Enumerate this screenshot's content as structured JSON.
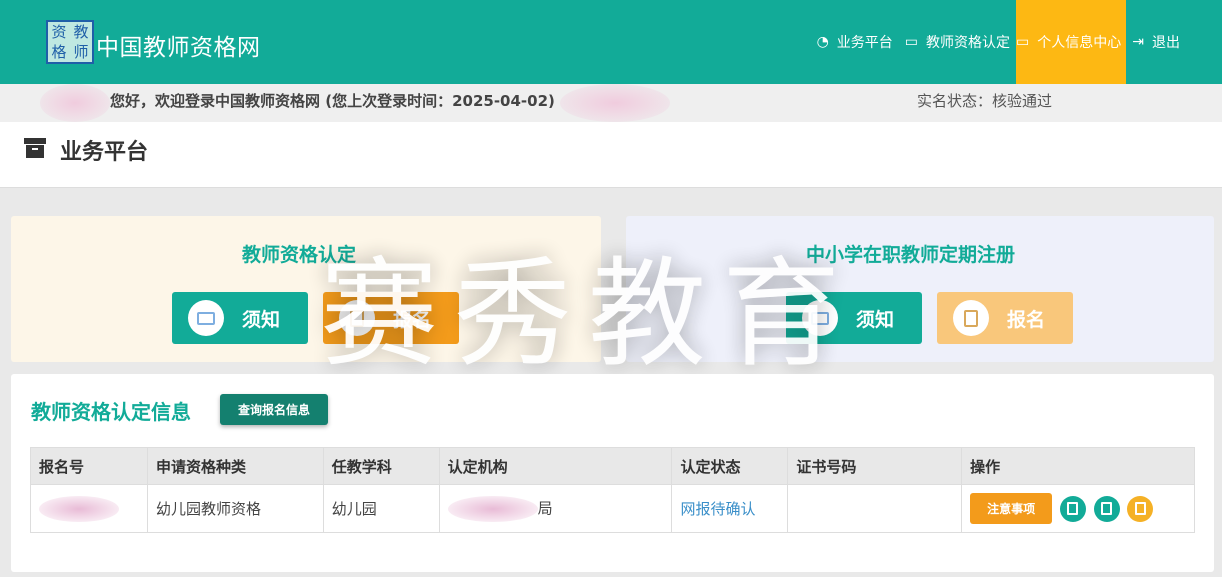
{
  "header": {
    "logo_chars": [
      "资",
      "教",
      "格",
      "师"
    ],
    "site_title": "中国教师资格网",
    "nav": [
      {
        "icon": "dashboard-icon",
        "label": "业务平台"
      },
      {
        "icon": "laptop-icon",
        "label": "教师资格认定"
      },
      {
        "icon": "laptop-icon",
        "label": "个人信息中心",
        "active": true
      },
      {
        "icon": "logout-icon",
        "label": "退出"
      }
    ]
  },
  "welcome": {
    "text": "您好，欢迎登录中国教师资格网 (您上次登录时间：2025-04-02)",
    "real_name_status": "实名状态：核验通过"
  },
  "page": {
    "title": "业务平台"
  },
  "panels": {
    "left": {
      "title": "教师资格认定",
      "notice_label": "须知",
      "signup_label": "报名"
    },
    "right": {
      "title": "中小学在职教师定期注册",
      "notice_label": "须知",
      "signup_label": "报名"
    }
  },
  "watermark": "赛秀教育",
  "info": {
    "title": "教师资格认定信息",
    "query_button": "查询报名信息",
    "columns": [
      "报名号",
      "申请资格种类",
      "任教学科",
      "认定机构",
      "认定状态",
      "证书号码",
      "操作"
    ],
    "rows": [
      {
        "qualification": "幼儿园教师资格",
        "subject": "幼儿园",
        "agency_suffix": "局",
        "status": "网报待确认",
        "certificate": "",
        "notice_button": "注意事项"
      }
    ]
  },
  "colors": {
    "primary": "#12ab98",
    "accent": "#fdb813",
    "orange": "#f39b1b",
    "link": "#3a8fc9"
  }
}
